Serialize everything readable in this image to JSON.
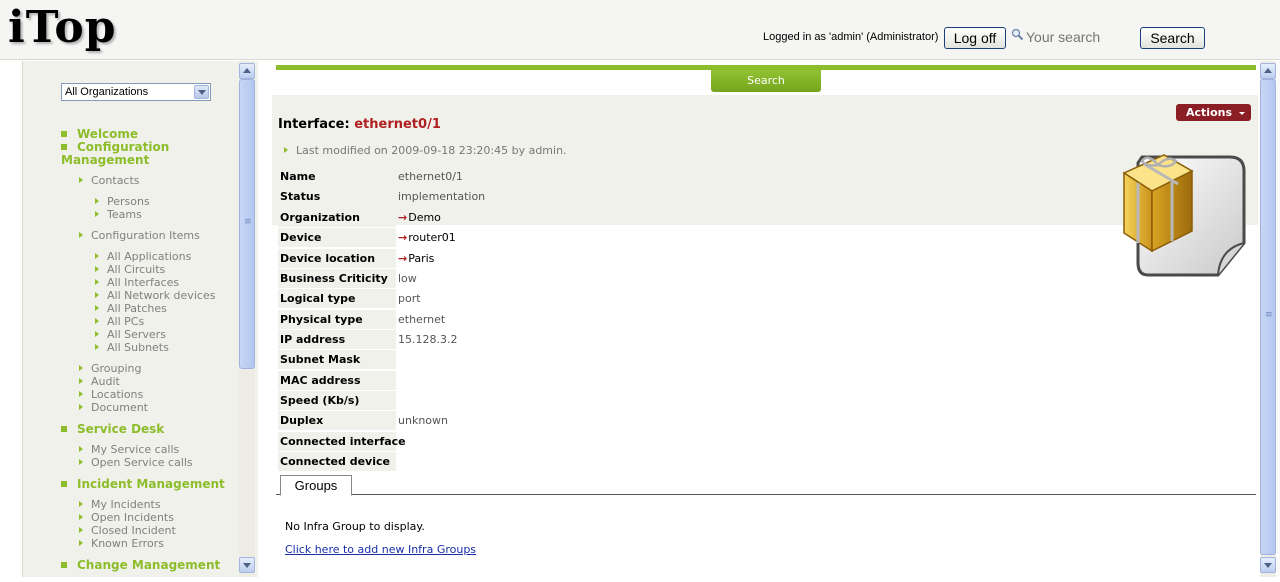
{
  "header": {
    "logo": "iTop",
    "logged_in": "Logged in as 'admin' (Administrator)",
    "logoff_label": "Log off",
    "search_placeholder": "Your search",
    "search_label": "Search"
  },
  "nav": {
    "org_select": "All Organizations",
    "sections": [
      {
        "label": "Welcome"
      },
      {
        "label": "Configuration Management",
        "line1": "Configuration",
        "line2": "Management"
      },
      {
        "label": "Service Desk"
      },
      {
        "label": "Incident Management"
      },
      {
        "label": "Change Management"
      }
    ],
    "contacts": "Contacts",
    "persons": "Persons",
    "teams": "Teams",
    "config_items": "Configuration Items",
    "ci_items": [
      "All Applications",
      "All Circuits",
      "All Interfaces",
      "All Network devices",
      "All Patches",
      "All PCs",
      "All Servers",
      "All Subnets"
    ],
    "other_items": [
      "Grouping",
      "Audit",
      "Locations",
      "Document"
    ],
    "service_items": [
      "My Service calls",
      "Open Service calls"
    ],
    "incident_items": [
      "My Incidents",
      "Open Incidents",
      "Closed Incident",
      "Known Errors"
    ]
  },
  "main": {
    "search_tab": "Search",
    "title_prefix": "Interface:",
    "title_object": "ethernet0/1",
    "last_modified": "Last modified on 2009-09-18 23:20:45 by admin.",
    "actions_label": "Actions",
    "properties": [
      {
        "label": "Name",
        "value": "ethernet0/1"
      },
      {
        "label": "Status",
        "value": "implementation"
      },
      {
        "label": "Organization",
        "value": "Demo",
        "ext": true
      },
      {
        "label": "Device",
        "value": "router01",
        "ext": true
      },
      {
        "label": "Device location",
        "value": "Paris",
        "ext": true
      },
      {
        "label": "Business Criticity",
        "value": "low"
      },
      {
        "label": "Logical type",
        "value": "port"
      },
      {
        "label": "Physical type",
        "value": "ethernet"
      },
      {
        "label": "IP address",
        "value": "15.128.3.2"
      },
      {
        "label": "Subnet Mask",
        "value": ""
      },
      {
        "label": "MAC address",
        "value": ""
      },
      {
        "label": "Speed (Kb/s)",
        "value": ""
      },
      {
        "label": "Duplex",
        "value": "unknown"
      },
      {
        "label": "Connected interface",
        "value": ""
      },
      {
        "label": "Connected device",
        "value": ""
      }
    ],
    "tab_groups": "Groups",
    "no_group": "No Infra Group to display.",
    "add_link": "Click here to add new Infra Groups"
  },
  "colors": {
    "accent_green": "#8dbd2b",
    "actions_red": "#8b1e24",
    "title_red": "#b02020",
    "link_blue": "#1a2ea8"
  }
}
